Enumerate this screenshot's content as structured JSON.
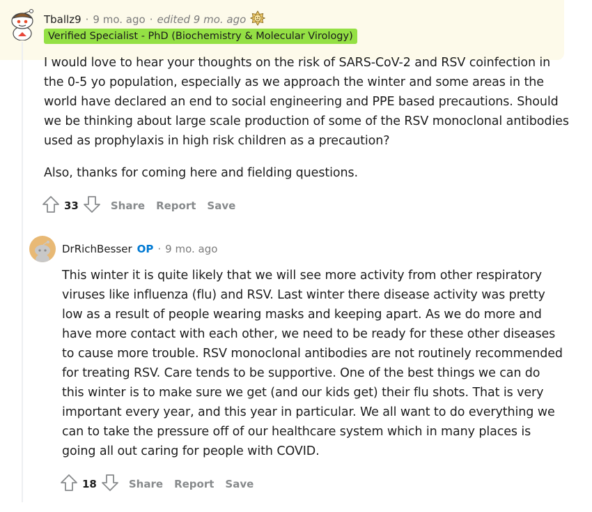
{
  "comments": [
    {
      "author": "Tballz9",
      "time": "9 mo. ago",
      "edited": "edited 9 mo. ago",
      "flair": "Verified Specialist - PhD (Biochemistry & Molecular Virology)",
      "paragraphs": [
        "I would love to hear your thoughts on the risk of SARS-CoV-2 and RSV coinfection in the 0-5 yo population, especially as we approach the winter and some areas in the world have declared an end to social engineering and PPE based precautions. Should we be thinking about large scale production of some of the RSV monoclonal antibodies used as prophylaxis in high risk children as a precaution?",
        "Also, thanks for coming here and fielding questions."
      ],
      "votes": "33",
      "actions": {
        "share": "Share",
        "report": "Report",
        "save": "Save"
      }
    },
    {
      "author": "DrRichBesser",
      "op_label": "OP",
      "time": "9 mo. ago",
      "paragraphs": [
        "This winter it is quite likely that we will see more activity from other respiratory viruses like influenza (flu) and RSV. Last winter there disease activity was pretty low as a result of people wearing masks and keeping apart. As we do more and have more contact with each other, we need to be ready for these other diseases to cause more trouble. RSV monoclonal antibodies are not routinely recommended for treating RSV. Care tends to be supportive. One of the best things we can do this winter is to make sure we get (and our kids get) their flu shots. That is very important every year, and this year in particular. We all want to do everything we can to take the pressure off of our healthcare system which in many places is going all out caring for people with COVID."
      ],
      "votes": "18",
      "actions": {
        "share": "Share",
        "report": "Report",
        "save": "Save"
      }
    }
  ],
  "colors": {
    "flair_bg": "#94e044",
    "op": "#0079d3",
    "highlight": "#fdfaea",
    "meta": "#7c7c7c",
    "action": "#878a8c"
  },
  "icons": [
    "snoo-avatar-icon",
    "award-icon",
    "upvote-icon",
    "downvote-icon",
    "user-avatar-icon"
  ]
}
